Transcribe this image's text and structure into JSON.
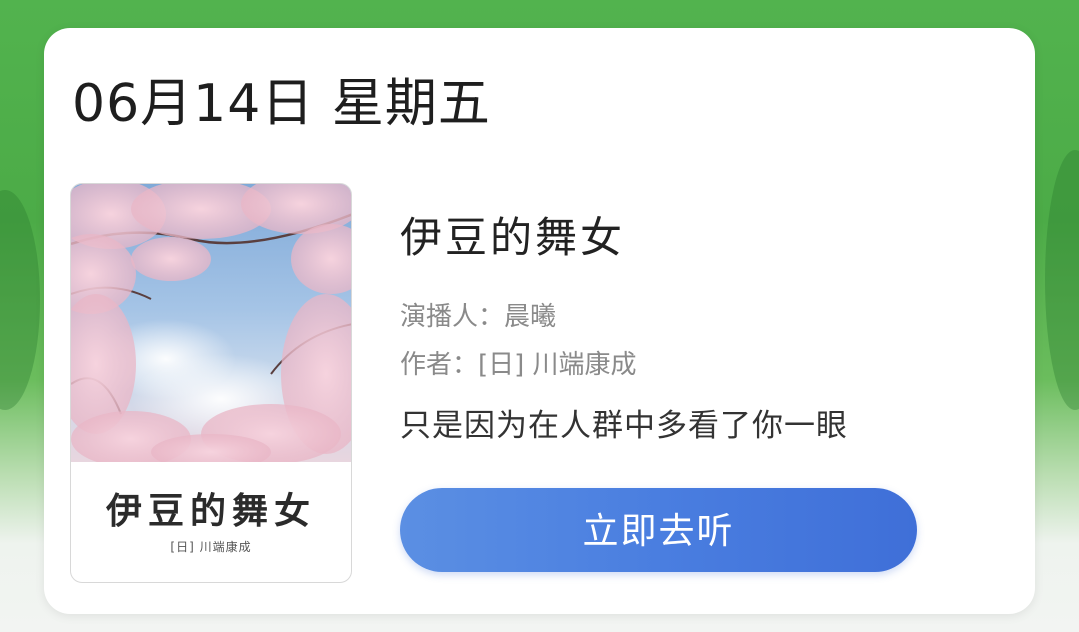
{
  "date": {
    "text": "06月14日 星期五"
  },
  "book": {
    "title": "伊豆的舞女",
    "narrator_line": "演播人：晨曦",
    "author_line": "作者：[日] 川端康成",
    "slogan": "只是因为在人群中多看了你一眼"
  },
  "cover": {
    "title": "伊豆的舞女",
    "author": "[日] 川端康成"
  },
  "actions": {
    "listen_label": "立即去听"
  },
  "colors": {
    "button_start": "#5b8fe3",
    "button_end": "#3f6fd8",
    "background_green": "#4cab47"
  }
}
